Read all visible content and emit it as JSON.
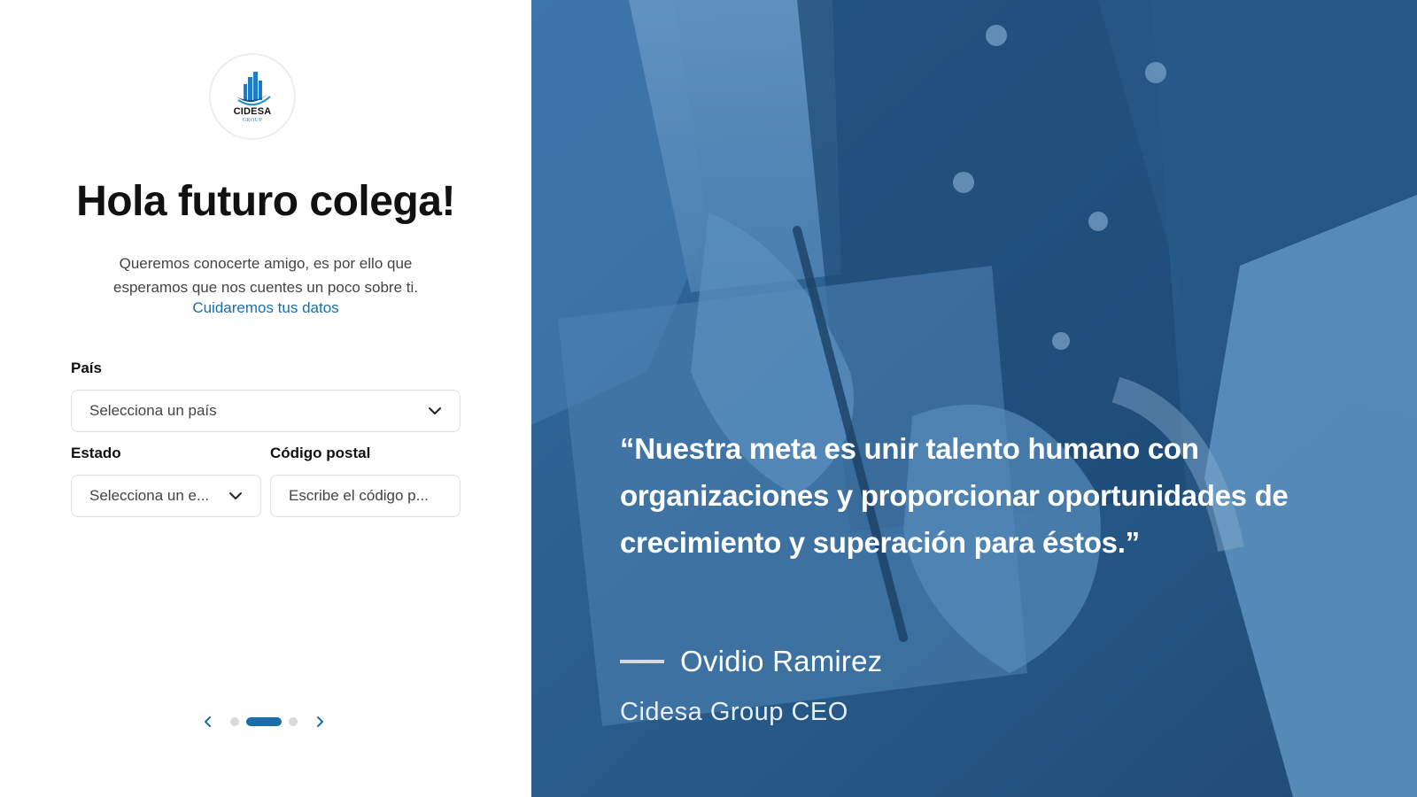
{
  "brand": {
    "name": "CIDESA",
    "sub": "GROUP"
  },
  "welcome": {
    "title": "Hola futuro colega!",
    "subtitle": "Queremos conocerte amigo, es por ello que esperamos que nos cuentes un poco sobre ti.",
    "privacy_link": "Cuidaremos tus datos"
  },
  "form": {
    "country": {
      "label": "País",
      "placeholder": "Selecciona un país"
    },
    "state": {
      "label": "Estado",
      "placeholder": "Selecciona un e..."
    },
    "postal": {
      "label": "Código postal",
      "placeholder": "Escribe el código p..."
    }
  },
  "pager": {
    "total": 3,
    "active_index": 1
  },
  "testimonial": {
    "quote": "“Nuestra meta es unir talento humano con organizaciones y proporcionar oportunidades de crecimiento y superación para éstos.”",
    "author": "Ovidio Ramirez",
    "role": "Cidesa Group CEO"
  },
  "icons": {
    "country_select": "chevron-down-icon",
    "state_select": "chevron-down-icon",
    "prev": "chevron-left-icon",
    "next": "chevron-right-icon"
  },
  "colors": {
    "accent": "#1a6ea8",
    "overlay": "#2b5d8c",
    "title": "#111111",
    "text": "#444444"
  }
}
